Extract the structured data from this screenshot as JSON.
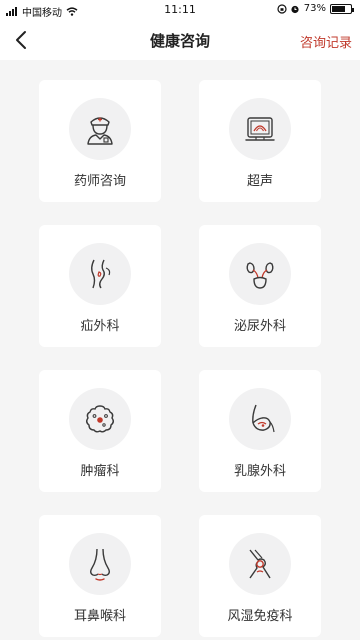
{
  "status_bar": {
    "carrier": "中国移动",
    "time": "11:11",
    "battery": "73%",
    "battery_level": 0.73
  },
  "header": {
    "title": "健康咨询",
    "right_action": "咨询记录",
    "back_icon": "chevron-left-icon"
  },
  "colors": {
    "accent": "#c0392b",
    "icon_stroke": "#3a3a3a",
    "card_bg": "#ffffff",
    "page_bg": "#f5f5f5",
    "icon_circle": "#f1f1f2"
  },
  "categories": [
    {
      "label": "药师咨询",
      "icon": "pharmacist-icon"
    },
    {
      "label": "超声",
      "icon": "ultrasound-monitor-icon"
    },
    {
      "label": "疝外科",
      "icon": "hernia-icon"
    },
    {
      "label": "泌尿外科",
      "icon": "kidney-urinary-icon"
    },
    {
      "label": "肿瘤科",
      "icon": "tumor-cell-icon"
    },
    {
      "label": "乳腺外科",
      "icon": "breast-icon"
    },
    {
      "label": "耳鼻喉科",
      "icon": "nose-icon"
    },
    {
      "label": "风湿免疫科",
      "icon": "joint-icon"
    }
  ]
}
